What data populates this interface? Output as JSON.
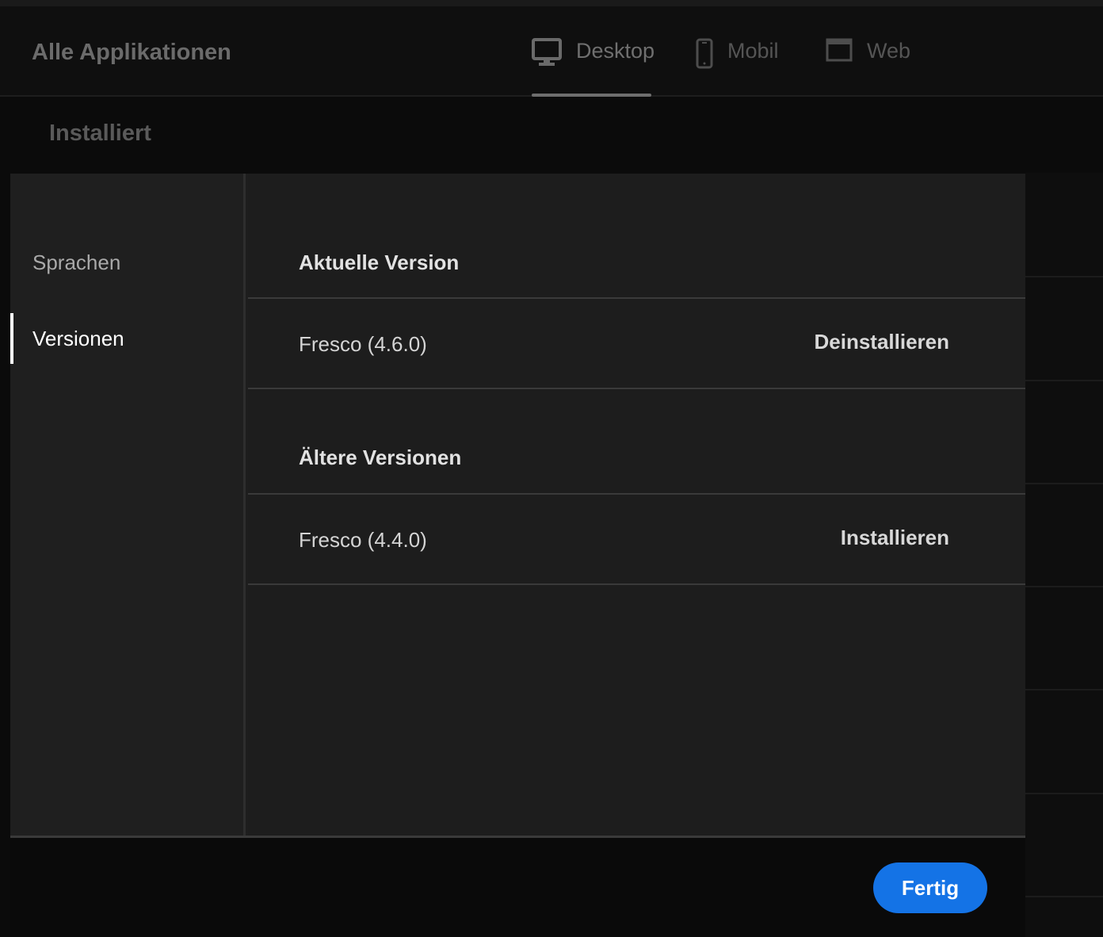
{
  "header": {
    "title": "Alle Applikationen",
    "tabs": [
      {
        "label": "Desktop",
        "icon": "desktop-monitor-icon",
        "active": true
      },
      {
        "label": "Mobil",
        "icon": "mobile-phone-icon",
        "active": false
      },
      {
        "label": "Web",
        "icon": "browser-window-icon",
        "active": false
      }
    ]
  },
  "background": {
    "section_label": "Installiert"
  },
  "dialog": {
    "sidebar": {
      "items": [
        {
          "label": "Sprachen",
          "active": false
        },
        {
          "label": "Versionen",
          "active": true
        }
      ]
    },
    "current": {
      "heading": "Aktuelle Version",
      "name": "Fresco (4.6.0)",
      "action": "Deinstallieren"
    },
    "older": {
      "heading": "Ältere Versionen",
      "items": [
        {
          "name": "Fresco (4.4.0)",
          "action": "Installieren"
        }
      ]
    },
    "footer": {
      "done_label": "Fertig"
    }
  },
  "colors": {
    "accent": "#1473e6",
    "background": "#0b0b0b",
    "panel": "#1e1e1e"
  }
}
